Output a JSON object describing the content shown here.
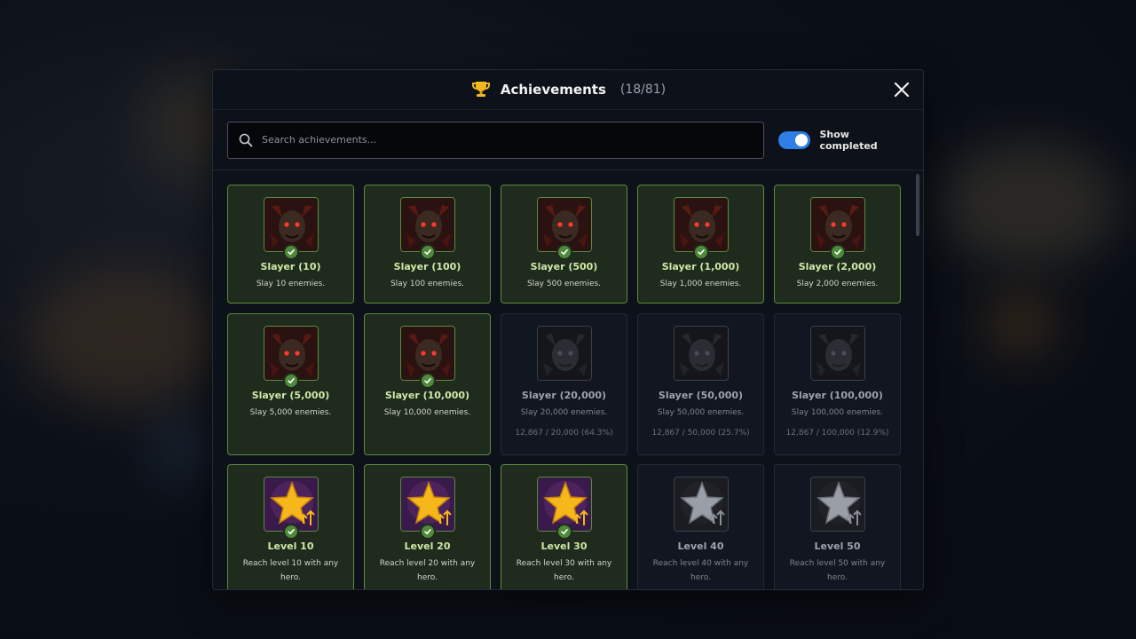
{
  "header": {
    "title": "Achievements",
    "count": "(18/81)",
    "trophy_icon": "trophy-icon",
    "close_icon": "close-icon"
  },
  "search": {
    "placeholder": "Search achievements...",
    "value": ""
  },
  "toggle": {
    "label": "Show completed",
    "on": true,
    "accent": "#2e7ee6"
  },
  "colors": {
    "completed_border": "#5c8a3f",
    "completed_bg": "#1f2b1c",
    "locked_bg": "#121620"
  },
  "achievements": [
    {
      "title": "Slayer (10)",
      "desc": "Slay 10 enemies.",
      "done": true,
      "icon": "demon-icon"
    },
    {
      "title": "Slayer (100)",
      "desc": "Slay 100 enemies.",
      "done": true,
      "icon": "demon-icon"
    },
    {
      "title": "Slayer (500)",
      "desc": "Slay 500 enemies.",
      "done": true,
      "icon": "demon-icon"
    },
    {
      "title": "Slayer (1,000)",
      "desc": "Slay 1,000 enemies.",
      "done": true,
      "icon": "demon-icon"
    },
    {
      "title": "Slayer (2,000)",
      "desc": "Slay 2,000 enemies.",
      "done": true,
      "icon": "demon-icon"
    },
    {
      "title": "Slayer (5,000)",
      "desc": "Slay 5,000 enemies.",
      "done": true,
      "icon": "demon-icon"
    },
    {
      "title": "Slayer (10,000)",
      "desc": "Slay 10,000 enemies.",
      "done": true,
      "icon": "demon-icon"
    },
    {
      "title": "Slayer (20,000)",
      "desc": "Slay 20,000 enemies.",
      "done": false,
      "progress": "12,867 / 20,000 (64.3%)",
      "icon": "demon-icon"
    },
    {
      "title": "Slayer (50,000)",
      "desc": "Slay 50,000 enemies.",
      "done": false,
      "progress": "12,867 / 50,000 (25.7%)",
      "icon": "demon-icon"
    },
    {
      "title": "Slayer (100,000)",
      "desc": "Slay 100,000 enemies.",
      "done": false,
      "progress": "12,867 / 100,000 (12.9%)",
      "icon": "demon-icon"
    },
    {
      "title": "Level 10",
      "desc": "Reach level 10 with any hero.",
      "done": true,
      "icon": "star-icon"
    },
    {
      "title": "Level 20",
      "desc": "Reach level 20 with any hero.",
      "done": true,
      "icon": "star-icon"
    },
    {
      "title": "Level 30",
      "desc": "Reach level 30 with any hero.",
      "done": true,
      "icon": "star-icon"
    },
    {
      "title": "Level 40",
      "desc": "Reach level 40 with any hero.",
      "done": false,
      "icon": "star-icon"
    },
    {
      "title": "Level 50",
      "desc": "Reach level 50 with any hero.",
      "done": false,
      "icon": "star-icon"
    }
  ]
}
